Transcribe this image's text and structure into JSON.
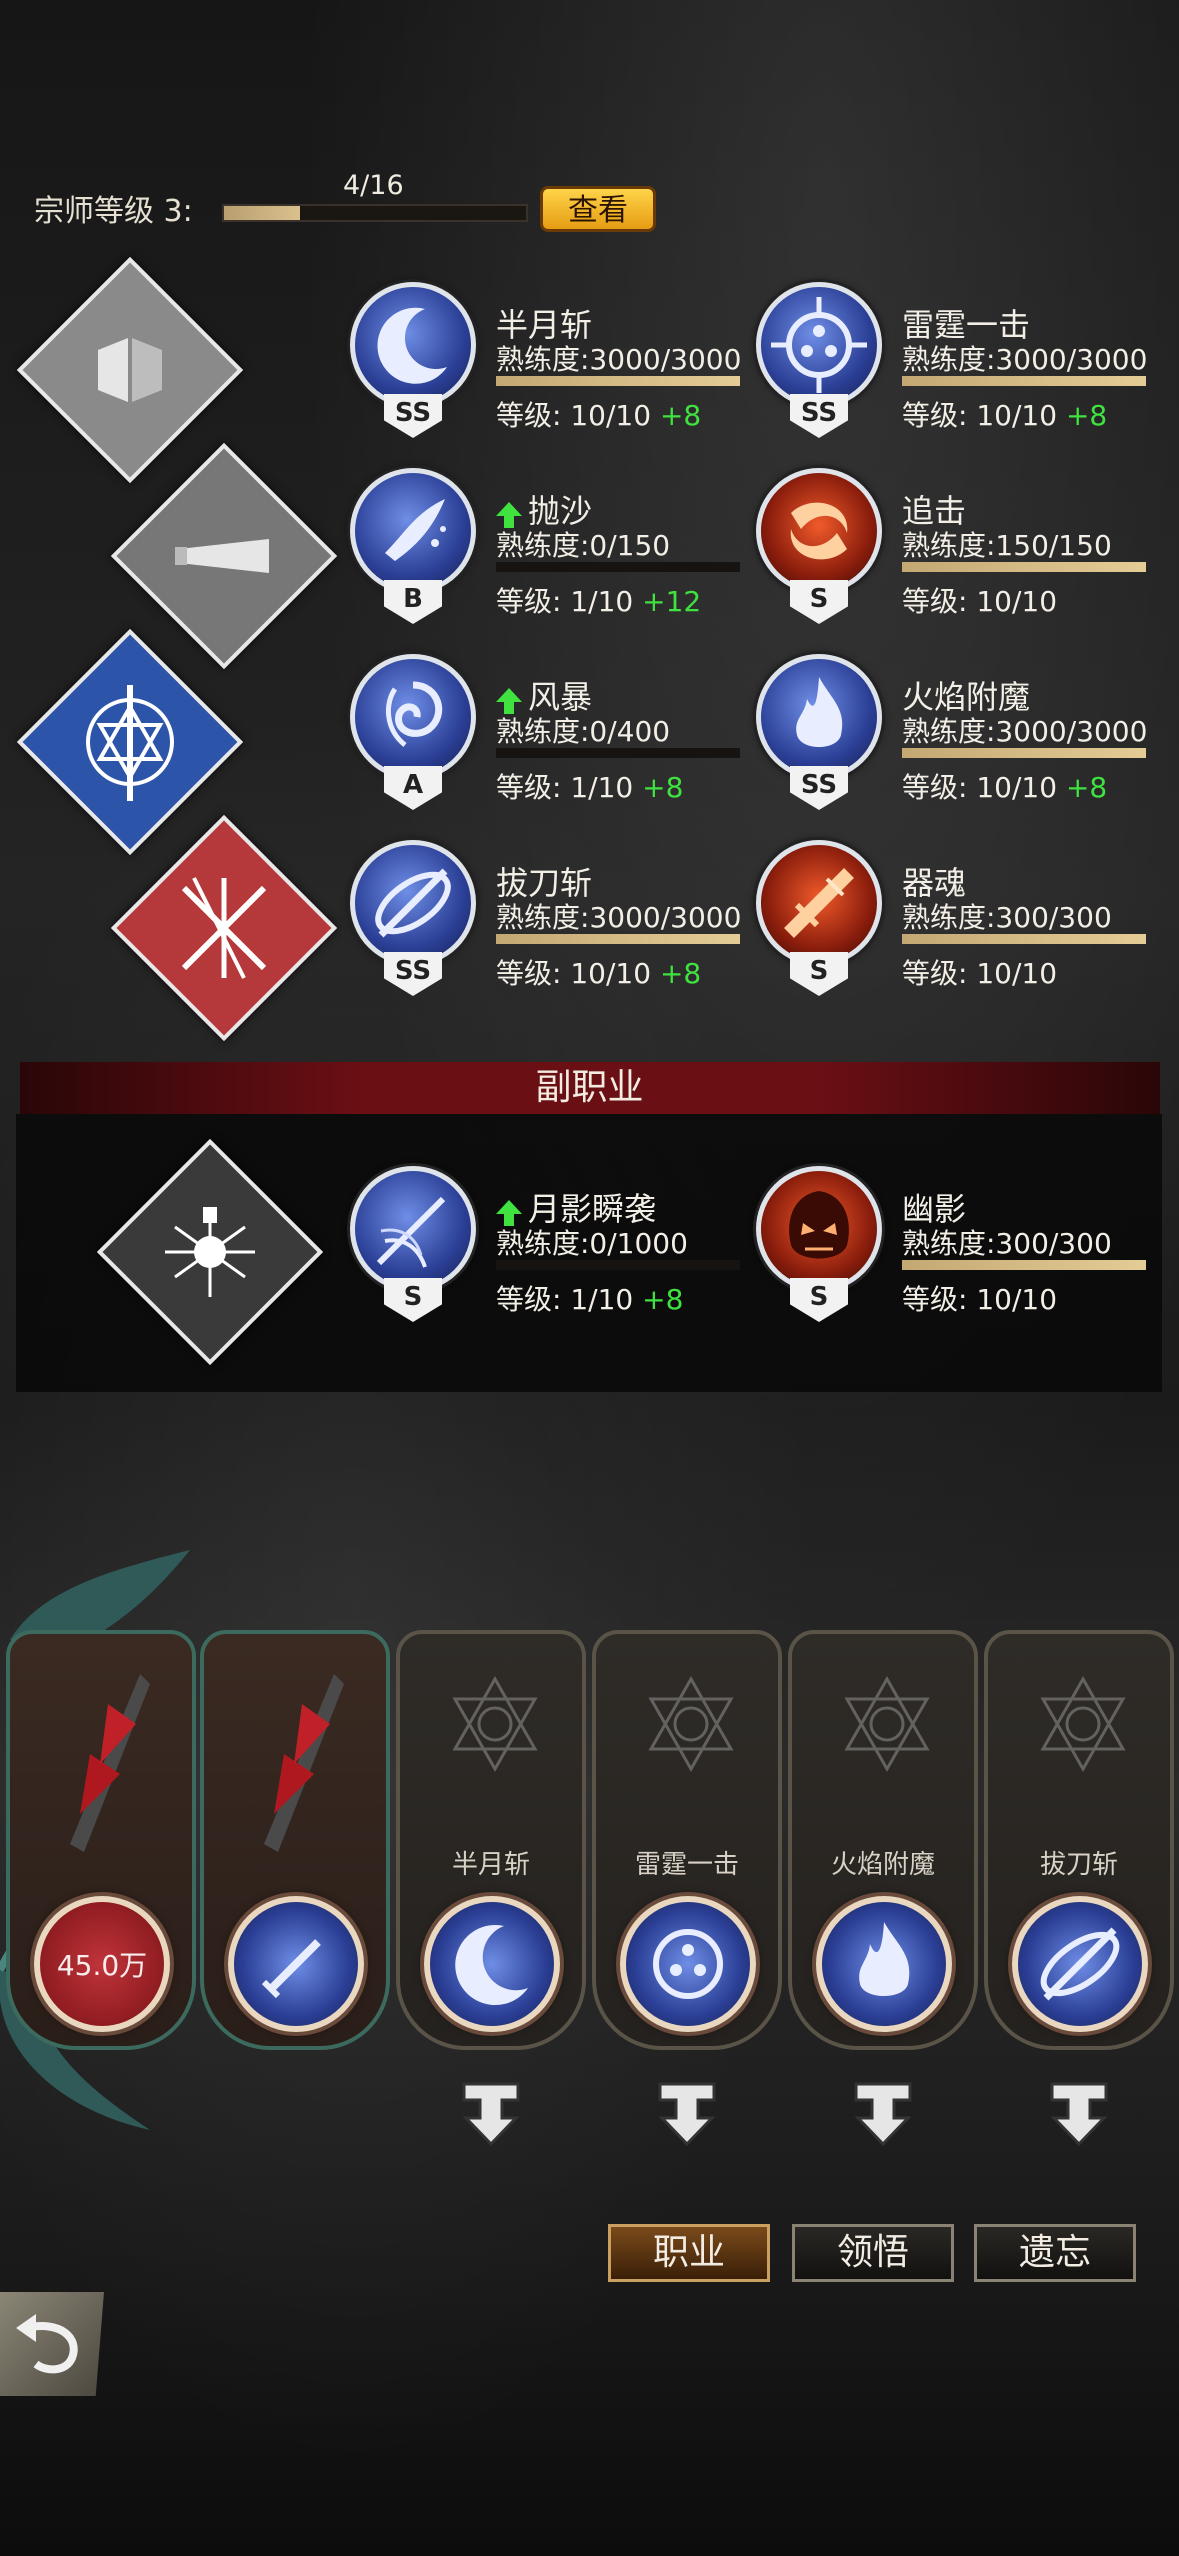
{
  "grandmaster": {
    "label": "宗师等级 3:",
    "progress_text": "4/16",
    "progress": 0.25,
    "view_button": "查看"
  },
  "classes": [
    {
      "name": "book-class-icon",
      "color": "#8c8c8c"
    },
    {
      "name": "spyglass-class-icon",
      "color": "#7a7a7a"
    },
    {
      "name": "hexagram-sword-class-icon",
      "color": "#2a52a8"
    },
    {
      "name": "blades-class-icon",
      "color": "#b5383a"
    }
  ],
  "skills": [
    {
      "name": "半月斩",
      "prof": "熟练度:3000/3000",
      "prof_ratio": 1.0,
      "level": "等级: 10/10",
      "bonus": "+8",
      "grade": "SS",
      "theme": "blue",
      "upgrade": false
    },
    {
      "name": "雷霆一击",
      "prof": "熟练度:3000/3000",
      "prof_ratio": 1.0,
      "level": "等级: 10/10",
      "bonus": "+8",
      "grade": "SS",
      "theme": "blue",
      "upgrade": false
    },
    {
      "name": "抛沙",
      "prof": "熟练度:0/150",
      "prof_ratio": 0.0,
      "level": "等级: 1/10",
      "bonus": "+12",
      "grade": "B",
      "theme": "blue",
      "upgrade": true
    },
    {
      "name": "追击",
      "prof": "熟练度:150/150",
      "prof_ratio": 1.0,
      "level": "等级: 10/10",
      "bonus": "",
      "grade": "S",
      "theme": "red",
      "upgrade": false
    },
    {
      "name": "风暴",
      "prof": "熟练度:0/400",
      "prof_ratio": 0.0,
      "level": "等级: 1/10",
      "bonus": "+8",
      "grade": "A",
      "theme": "blue",
      "upgrade": true
    },
    {
      "name": "火焰附魔",
      "prof": "熟练度:3000/3000",
      "prof_ratio": 1.0,
      "level": "等级: 10/10",
      "bonus": "+8",
      "grade": "SS",
      "theme": "blue",
      "upgrade": false
    },
    {
      "name": "拔刀斩",
      "prof": "熟练度:3000/3000",
      "prof_ratio": 1.0,
      "level": "等级: 10/10",
      "bonus": "+8",
      "grade": "SS",
      "theme": "blue",
      "upgrade": false
    },
    {
      "name": "器魂",
      "prof": "熟练度:300/300",
      "prof_ratio": 1.0,
      "level": "等级: 10/10",
      "bonus": "",
      "grade": "S",
      "theme": "red",
      "upgrade": false
    }
  ],
  "sub_job": {
    "title": "副职业",
    "skills": [
      {
        "name": "月影瞬袭",
        "prof": "熟练度:0/1000",
        "prof_ratio": 0.0,
        "level": "等级: 1/10",
        "bonus": "+8",
        "grade": "S",
        "theme": "blue",
        "upgrade": true
      },
      {
        "name": "幽影",
        "prof": "熟练度:300/300",
        "prof_ratio": 1.0,
        "level": "等级: 10/10",
        "bonus": "",
        "grade": "S",
        "theme": "red",
        "upgrade": false
      }
    ]
  },
  "slots": [
    {
      "label": "",
      "price": "45.0万",
      "kind": "weapon"
    },
    {
      "label": "",
      "price": "",
      "kind": "weapon"
    },
    {
      "label": "半月斩",
      "price": "",
      "kind": "skill"
    },
    {
      "label": "雷霆一击",
      "price": "",
      "kind": "skill"
    },
    {
      "label": "火焰附魔",
      "price": "",
      "kind": "skill"
    },
    {
      "label": "拔刀斩",
      "price": "",
      "kind": "skill"
    }
  ],
  "tabs": [
    {
      "label": "职业",
      "active": true
    },
    {
      "label": "领悟",
      "active": false
    },
    {
      "label": "遗忘",
      "active": false
    }
  ],
  "colors": {
    "gold": "#e5b02a",
    "green": "#3fe23f",
    "sub_banner": "#6a0f14"
  }
}
